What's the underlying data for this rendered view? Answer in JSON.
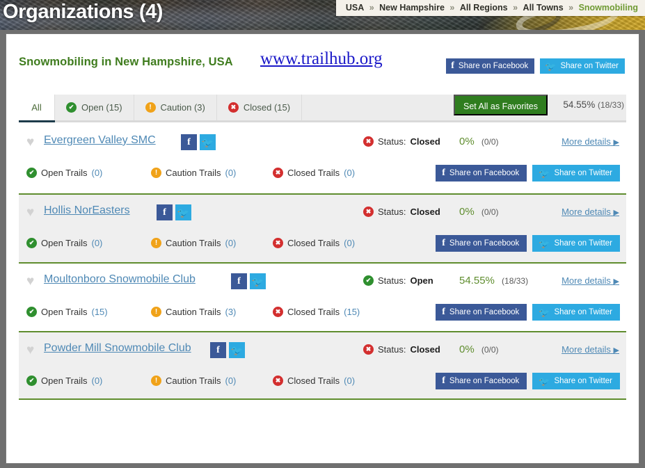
{
  "banner": {
    "title": "Organizations (4)"
  },
  "breadcrumb": {
    "separator": "»",
    "items": [
      "USA",
      "New Hampshire",
      "All Regions",
      "All Towns",
      "Snowmobiling"
    ]
  },
  "header": {
    "page_title": "Snowmobiling in New Hampshire, USA",
    "site_url": "www.trailhub.org",
    "share_facebook": "Share on Facebook",
    "share_twitter": "Share on Twitter"
  },
  "tabs": {
    "items": [
      {
        "label": "All",
        "icon": "none",
        "active": true
      },
      {
        "label": "Open (15)",
        "icon": "check-circle",
        "active": false
      },
      {
        "label": "Caution (3)",
        "icon": "exclaim-circle",
        "active": false
      },
      {
        "label": "Closed (15)",
        "icon": "x-circle",
        "active": false
      }
    ],
    "favorites_button": "Set All as Favorites",
    "summary_percent": "54.55%",
    "summary_fraction": "(18/33)"
  },
  "labels": {
    "status_prefix": "Status:",
    "more_details": "More details",
    "caret": "▶",
    "open_trails": "Open Trails",
    "caution_trails": "Caution Trails",
    "closed_trails": "Closed Trails",
    "heart": "♥",
    "fb_glyph": "f",
    "tw_glyph": "🐦"
  },
  "colors": {
    "brand_green": "#3f7c1e",
    "link_blue": "#4f89b5",
    "url_blue": "#1a18c8",
    "facebook": "#3b5998",
    "twitter": "#2daae1",
    "status_open": "#2f8f2f",
    "status_caution": "#f0a219",
    "status_closed": "#d32f2f",
    "row_divider": "#5f8d2e",
    "tab_active_underline": "#1d3b4a"
  },
  "organizations": [
    {
      "name": "Evergreen Valley SMC",
      "status": "Closed",
      "status_icon": "x-circle",
      "percent": "0%",
      "fraction": "(0/0)",
      "open_trails": "(0)",
      "caution_trails": "(0)",
      "closed_trails": "(0)",
      "more_details": "More details",
      "share_facebook": "Share on Facebook",
      "share_twitter": "Share on Twitter",
      "alt_background": false
    },
    {
      "name": "Hollis NorEasters",
      "status": "Closed",
      "status_icon": "x-circle",
      "percent": "0%",
      "fraction": "(0/0)",
      "open_trails": "(0)",
      "caution_trails": "(0)",
      "closed_trails": "(0)",
      "more_details": "More details",
      "share_facebook": "Share on Facebook",
      "share_twitter": "Share on Twitter",
      "alt_background": true
    },
    {
      "name": "Moultonboro Snowmobile Club",
      "status": "Open",
      "status_icon": "check-circle",
      "percent": "54.55%",
      "fraction": "(18/33)",
      "open_trails": "(15)",
      "caution_trails": "(3)",
      "closed_trails": "(15)",
      "more_details": "More details",
      "share_facebook": "Share on Facebook",
      "share_twitter": "Share on Twitter",
      "alt_background": false
    },
    {
      "name": "Powder Mill Snowmobile Club",
      "status": "Closed",
      "status_icon": "x-circle",
      "percent": "0%",
      "fraction": "(0/0)",
      "open_trails": "(0)",
      "caution_trails": "(0)",
      "closed_trails": "(0)",
      "more_details": "More details",
      "share_facebook": "Share on Facebook",
      "share_twitter": "Share on Twitter",
      "alt_background": true
    }
  ]
}
